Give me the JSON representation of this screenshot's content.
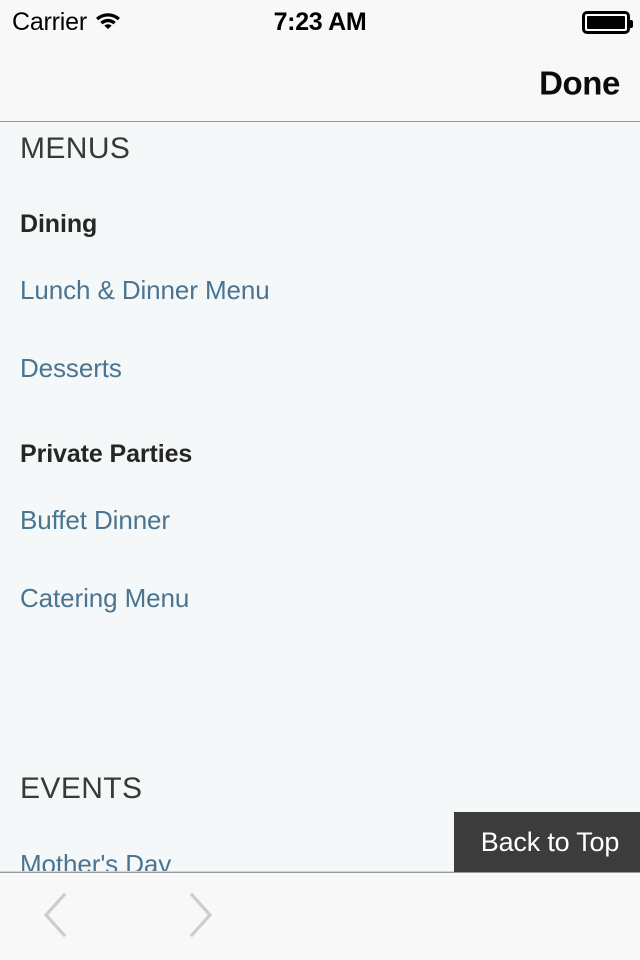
{
  "status_bar": {
    "carrier": "Carrier",
    "wifi_icon": "wifi-icon",
    "time": "7:23 AM",
    "battery_icon": "battery-full-icon"
  },
  "nav_bar": {
    "title": "",
    "done_label": "Done"
  },
  "content": {
    "sections": [
      {
        "heading": "MENUS",
        "groups": [
          {
            "title": "Dining",
            "links": [
              "Lunch & Dinner Menu",
              "Desserts"
            ]
          },
          {
            "title": "Private Parties",
            "links": [
              "Buffet Dinner",
              "Catering Menu"
            ]
          }
        ]
      },
      {
        "heading": "EVENTS",
        "groups": [
          {
            "title": "",
            "links": [
              "Mother's Day"
            ]
          }
        ]
      }
    ]
  },
  "back_to_top": {
    "label": "Back to Top"
  },
  "toolbar": {
    "back_icon": "chevron-left-icon",
    "forward_icon": "chevron-right-icon"
  },
  "colors": {
    "page_background": "#f5f8f9",
    "chrome_background": "#f8f8f8",
    "link": "#4a7490",
    "heading": "#393939",
    "group_title": "#262626",
    "back_to_top_background": "#3c3c3c",
    "toolbar_icon_disabled": "#cdcdcd",
    "separator": "#9a9a9a"
  }
}
